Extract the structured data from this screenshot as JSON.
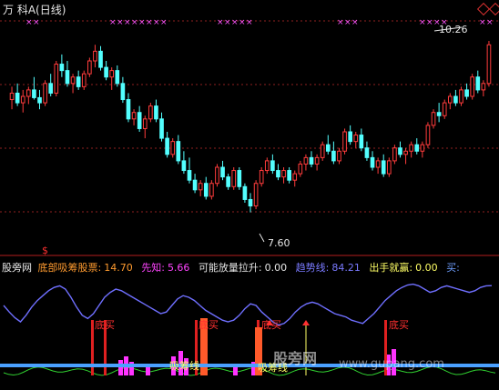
{
  "window": {
    "title": "万  科A(日线)"
  },
  "colors": {
    "up": "#ff3c3c",
    "down": "#53ffff",
    "grid": "#b41e1e",
    "cross_marker": "#ff55ff",
    "dotted_grid": "#902020"
  },
  "price_panel": {
    "high_label": "10.26",
    "low_label": "7.60",
    "signal_marker": "$"
  },
  "indicator_header": {
    "source": "股旁网",
    "items": [
      {
        "label": "底部吸筹股票:",
        "value": "14.70",
        "color": "#ff9b2f"
      },
      {
        "label": "先知:",
        "value": "5.66",
        "color": "#ff44ff"
      },
      {
        "label": "可能放量拉升:",
        "value": "0.00",
        "color": "#e6e6e6"
      },
      {
        "label": "趋势线:",
        "value": "84.21",
        "color": "#7a7aff"
      },
      {
        "label": "出手就赢:",
        "value": "0.00",
        "color": "#ffff66"
      },
      {
        "label": "买:",
        "value": "",
        "color": "#6f9fff"
      }
    ]
  },
  "indicator_annotations": {
    "buy_label": "买",
    "bottom_label": "底",
    "bottom_buy_label": "底买",
    "accumulate_label": "吸筹线"
  },
  "watermark": {
    "text": "股旁网",
    "url": "www.gupang.com"
  },
  "chart_data": [
    {
      "type": "candlestick",
      "title": "万 科A(日线)",
      "ylim": [
        7.2,
        10.5
      ],
      "annotations": [
        {
          "label": "10.26",
          "kind": "high"
        },
        {
          "label": "7.60",
          "kind": "low"
        }
      ],
      "candles": [
        {
          "o": 9.35,
          "h": 9.55,
          "l": 9.2,
          "c": 9.45
        },
        {
          "o": 9.45,
          "h": 9.6,
          "l": 9.25,
          "c": 9.3
        },
        {
          "o": 9.3,
          "h": 9.5,
          "l": 9.15,
          "c": 9.4
        },
        {
          "o": 9.4,
          "h": 9.55,
          "l": 9.28,
          "c": 9.5
        },
        {
          "o": 9.5,
          "h": 9.7,
          "l": 9.35,
          "c": 9.38
        },
        {
          "o": 9.38,
          "h": 9.5,
          "l": 9.2,
          "c": 9.3
        },
        {
          "o": 9.3,
          "h": 9.65,
          "l": 9.25,
          "c": 9.6
        },
        {
          "o": 9.6,
          "h": 9.75,
          "l": 9.4,
          "c": 9.45
        },
        {
          "o": 9.45,
          "h": 9.95,
          "l": 9.4,
          "c": 9.9
        },
        {
          "o": 9.9,
          "h": 10.05,
          "l": 9.7,
          "c": 9.8
        },
        {
          "o": 9.8,
          "h": 9.95,
          "l": 9.55,
          "c": 9.6
        },
        {
          "o": 9.6,
          "h": 9.75,
          "l": 9.45,
          "c": 9.7
        },
        {
          "o": 9.7,
          "h": 9.8,
          "l": 9.5,
          "c": 9.55
        },
        {
          "o": 9.55,
          "h": 9.8,
          "l": 9.5,
          "c": 9.75
        },
        {
          "o": 9.75,
          "h": 10.0,
          "l": 9.7,
          "c": 9.95
        },
        {
          "o": 9.95,
          "h": 10.2,
          "l": 9.85,
          "c": 10.1
        },
        {
          "o": 10.1,
          "h": 10.18,
          "l": 9.8,
          "c": 9.85
        },
        {
          "o": 9.85,
          "h": 9.95,
          "l": 9.65,
          "c": 9.7
        },
        {
          "o": 9.7,
          "h": 9.85,
          "l": 9.5,
          "c": 9.8
        },
        {
          "o": 9.8,
          "h": 9.88,
          "l": 9.55,
          "c": 9.6
        },
        {
          "o": 9.6,
          "h": 9.7,
          "l": 9.3,
          "c": 9.35
        },
        {
          "o": 9.35,
          "h": 9.45,
          "l": 9.0,
          "c": 9.05
        },
        {
          "o": 9.05,
          "h": 9.2,
          "l": 8.95,
          "c": 9.15
        },
        {
          "o": 9.15,
          "h": 9.25,
          "l": 8.85,
          "c": 8.9
        },
        {
          "o": 8.9,
          "h": 9.1,
          "l": 8.75,
          "c": 9.05
        },
        {
          "o": 9.05,
          "h": 9.3,
          "l": 9.0,
          "c": 9.25
        },
        {
          "o": 9.25,
          "h": 9.35,
          "l": 9.0,
          "c": 9.05
        },
        {
          "o": 9.05,
          "h": 9.15,
          "l": 8.7,
          "c": 8.75
        },
        {
          "o": 8.75,
          "h": 8.85,
          "l": 8.45,
          "c": 8.5
        },
        {
          "o": 8.5,
          "h": 8.75,
          "l": 8.45,
          "c": 8.7
        },
        {
          "o": 8.7,
          "h": 8.8,
          "l": 8.35,
          "c": 8.4
        },
        {
          "o": 8.4,
          "h": 8.55,
          "l": 8.2,
          "c": 8.25
        },
        {
          "o": 8.25,
          "h": 8.45,
          "l": 8.05,
          "c": 8.1
        },
        {
          "o": 8.1,
          "h": 8.2,
          "l": 7.9,
          "c": 7.95
        },
        {
          "o": 7.95,
          "h": 8.1,
          "l": 7.85,
          "c": 8.05
        },
        {
          "o": 8.05,
          "h": 8.15,
          "l": 7.8,
          "c": 7.85
        },
        {
          "o": 7.85,
          "h": 8.1,
          "l": 7.8,
          "c": 8.05
        },
        {
          "o": 8.05,
          "h": 8.35,
          "l": 8.0,
          "c": 8.3
        },
        {
          "o": 8.3,
          "h": 8.4,
          "l": 8.1,
          "c": 8.15
        },
        {
          "o": 8.15,
          "h": 8.2,
          "l": 7.95,
          "c": 8.0
        },
        {
          "o": 8.0,
          "h": 8.3,
          "l": 7.95,
          "c": 8.25
        },
        {
          "o": 8.25,
          "h": 8.3,
          "l": 7.95,
          "c": 8.0
        },
        {
          "o": 8.0,
          "h": 8.05,
          "l": 7.75,
          "c": 7.8
        },
        {
          "o": 7.8,
          "h": 7.9,
          "l": 7.6,
          "c": 7.7
        },
        {
          "o": 7.7,
          "h": 8.1,
          "l": 7.65,
          "c": 8.05
        },
        {
          "o": 8.05,
          "h": 8.3,
          "l": 8.0,
          "c": 8.25
        },
        {
          "o": 8.25,
          "h": 8.45,
          "l": 8.2,
          "c": 8.4
        },
        {
          "o": 8.4,
          "h": 8.5,
          "l": 8.2,
          "c": 8.25
        },
        {
          "o": 8.25,
          "h": 8.35,
          "l": 8.1,
          "c": 8.15
        },
        {
          "o": 8.15,
          "h": 8.3,
          "l": 8.05,
          "c": 8.25
        },
        {
          "o": 8.25,
          "h": 8.3,
          "l": 8.05,
          "c": 8.1
        },
        {
          "o": 8.1,
          "h": 8.25,
          "l": 8.0,
          "c": 8.2
        },
        {
          "o": 8.2,
          "h": 8.4,
          "l": 8.15,
          "c": 8.35
        },
        {
          "o": 8.35,
          "h": 8.5,
          "l": 8.25,
          "c": 8.45
        },
        {
          "o": 8.45,
          "h": 8.55,
          "l": 8.3,
          "c": 8.35
        },
        {
          "o": 8.35,
          "h": 8.5,
          "l": 8.25,
          "c": 8.45
        },
        {
          "o": 8.45,
          "h": 8.7,
          "l": 8.4,
          "c": 8.65
        },
        {
          "o": 8.65,
          "h": 8.8,
          "l": 8.5,
          "c": 8.55
        },
        {
          "o": 8.55,
          "h": 8.7,
          "l": 8.35,
          "c": 8.4
        },
        {
          "o": 8.4,
          "h": 8.6,
          "l": 8.35,
          "c": 8.55
        },
        {
          "o": 8.55,
          "h": 8.9,
          "l": 8.5,
          "c": 8.85
        },
        {
          "o": 8.85,
          "h": 8.95,
          "l": 8.65,
          "c": 8.7
        },
        {
          "o": 8.7,
          "h": 8.85,
          "l": 8.6,
          "c": 8.8
        },
        {
          "o": 8.8,
          "h": 8.9,
          "l": 8.55,
          "c": 8.6
        },
        {
          "o": 8.6,
          "h": 8.7,
          "l": 8.4,
          "c": 8.45
        },
        {
          "o": 8.45,
          "h": 8.55,
          "l": 8.25,
          "c": 8.3
        },
        {
          "o": 8.3,
          "h": 8.45,
          "l": 8.2,
          "c": 8.4
        },
        {
          "o": 8.4,
          "h": 8.5,
          "l": 8.15,
          "c": 8.2
        },
        {
          "o": 8.2,
          "h": 8.45,
          "l": 8.15,
          "c": 8.4
        },
        {
          "o": 8.4,
          "h": 8.65,
          "l": 8.35,
          "c": 8.6
        },
        {
          "o": 8.6,
          "h": 8.7,
          "l": 8.45,
          "c": 8.5
        },
        {
          "o": 8.5,
          "h": 8.6,
          "l": 8.35,
          "c": 8.55
        },
        {
          "o": 8.55,
          "h": 8.7,
          "l": 8.45,
          "c": 8.65
        },
        {
          "o": 8.65,
          "h": 8.75,
          "l": 8.5,
          "c": 8.55
        },
        {
          "o": 8.55,
          "h": 8.7,
          "l": 8.45,
          "c": 8.65
        },
        {
          "o": 8.65,
          "h": 9.0,
          "l": 8.6,
          "c": 8.95
        },
        {
          "o": 8.95,
          "h": 9.2,
          "l": 8.9,
          "c": 9.15
        },
        {
          "o": 9.15,
          "h": 9.3,
          "l": 9.0,
          "c": 9.1
        },
        {
          "o": 9.1,
          "h": 9.35,
          "l": 9.05,
          "c": 9.3
        },
        {
          "o": 9.3,
          "h": 9.45,
          "l": 9.2,
          "c": 9.4
        },
        {
          "o": 9.4,
          "h": 9.5,
          "l": 9.25,
          "c": 9.3
        },
        {
          "o": 9.3,
          "h": 9.55,
          "l": 9.25,
          "c": 9.5
        },
        {
          "o": 9.5,
          "h": 9.6,
          "l": 9.35,
          "c": 9.4
        },
        {
          "o": 9.4,
          "h": 9.75,
          "l": 9.35,
          "c": 9.7
        },
        {
          "o": 9.7,
          "h": 9.8,
          "l": 9.45,
          "c": 9.5
        },
        {
          "o": 9.5,
          "h": 9.65,
          "l": 9.4,
          "c": 9.6
        },
        {
          "o": 9.6,
          "h": 10.26,
          "l": 9.55,
          "c": 10.2
        }
      ]
    },
    {
      "type": "line",
      "name": "趋势线",
      "ylim": [
        0,
        100
      ],
      "values": [
        60,
        52,
        45,
        40,
        48,
        58,
        66,
        72,
        78,
        82,
        84,
        80,
        70,
        58,
        48,
        44,
        50,
        60,
        70,
        76,
        80,
        78,
        74,
        70,
        66,
        62,
        58,
        54,
        50,
        52,
        60,
        68,
        72,
        70,
        66,
        60,
        54,
        50,
        46,
        42,
        40,
        42,
        48,
        56,
        62,
        60,
        52,
        46,
        40,
        36,
        38,
        44,
        52,
        58,
        62,
        64,
        62,
        58,
        54,
        50,
        48,
        46,
        42,
        40,
        38,
        44,
        50,
        58,
        66,
        72,
        78,
        82,
        85,
        86,
        84,
        80,
        76,
        78,
        82,
        84,
        82,
        80,
        78,
        76,
        78,
        82,
        84,
        84.21
      ]
    }
  ]
}
